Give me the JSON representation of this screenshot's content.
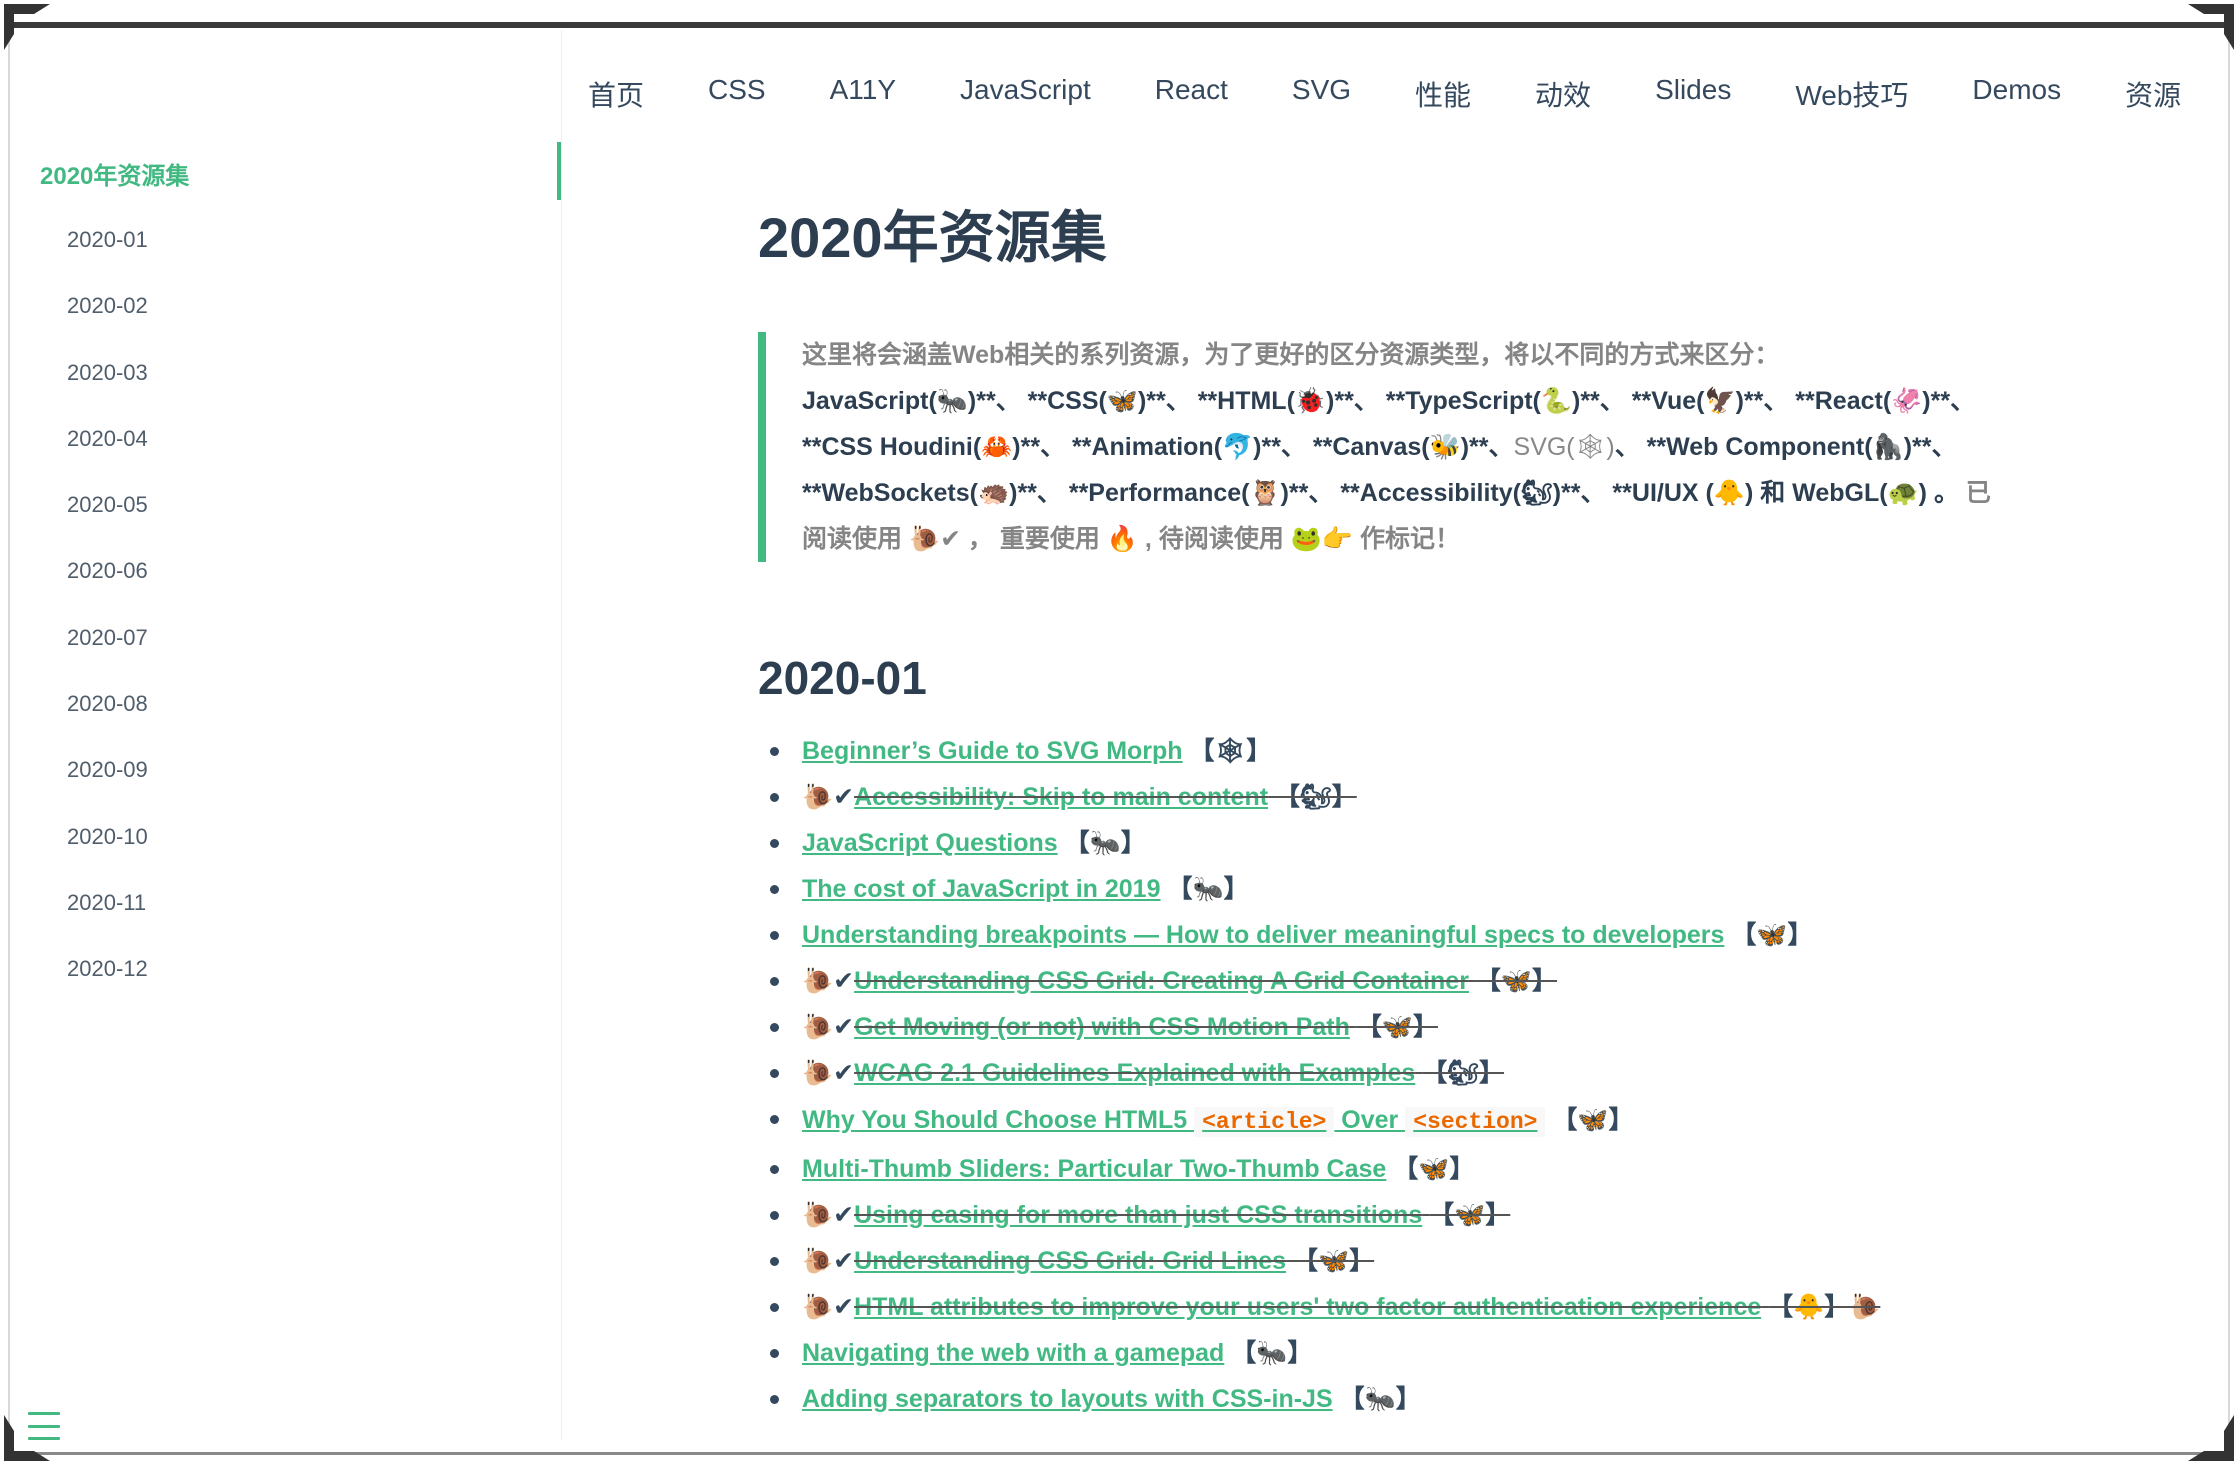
{
  "sidebar": {
    "active": "2020年资源集",
    "items": [
      "2020-01",
      "2020-02",
      "2020-03",
      "2020-04",
      "2020-05",
      "2020-06",
      "2020-07",
      "2020-08",
      "2020-09",
      "2020-10",
      "2020-11",
      "2020-12"
    ]
  },
  "nav": [
    "首页",
    "CSS",
    "A11Y",
    "JavaScript",
    "React",
    "SVG",
    "性能",
    "动效",
    "Slides",
    "Web技巧",
    "Demos",
    "资源"
  ],
  "page": {
    "title": "2020年资源集",
    "intro": {
      "line1": "这里将会涵盖Web相关的系列资源，为了更好的区分资源类型，将以不同的方式来区分：",
      "line2": "JavaScript(🐜)**、 **CSS(🦋)**、 **HTML(🐞)**、 **TypeScript(🐍)**、 **Vue(🦅)**、 **React(🦑)**、",
      "line3a": "**CSS Houdini(🦀)**、 **Animation(🐬)**、 **Canvas(🐝)**、",
      "line3svg": "SVG(🕸)",
      "line3b": "、 **Web Component(🦍)**、",
      "line4a": "**WebSockets(🦔)**、 **Performance(🦉)**、 **Accessibility(🐿)**、 **UI/UX (🐥) 和 WebGL(🐢) 。",
      "line4b": " 已",
      "line5": "阅读使用 🐌✔ ， 重要使用 🔥 , 待阅读使用 🐸👉 作标记！"
    },
    "section": "2020-01",
    "items": [
      {
        "prefix": "",
        "link": "Beginner’s Guide to SVG Morph",
        "tag": "【🕸】"
      },
      {
        "prefix": "🐌✔",
        "link": "Accessibility: Skip to main content",
        "tag": "【🐿】"
      },
      {
        "prefix": "",
        "link": "JavaScript Questions",
        "tag": "【🐜】"
      },
      {
        "prefix": "",
        "link": "The cost of JavaScript in 2019",
        "tag": "【🐜】"
      },
      {
        "prefix": "",
        "link": "Understanding breakpoints — How to deliver meaningful specs to developers",
        "tag": "【🦋】"
      },
      {
        "prefix": "🐌✔",
        "link": "Understanding CSS Grid: Creating A Grid Container",
        "tag": "【🦋】"
      },
      {
        "prefix": "🐌✔",
        "link": "Get Moving (or not) with CSS Motion Path",
        "tag": "【🦋】"
      },
      {
        "prefix": "🐌✔",
        "link": "WCAG 2.1 Guidelines Explained with Examples",
        "tag": "【🐿】"
      },
      {
        "prefix": "",
        "link": "Multi-Thumb Sliders: Particular Two-Thumb Case",
        "tag": "【🦋】"
      },
      {
        "prefix": "🐌✔",
        "link": "Using easing for more than just CSS transitions",
        "tag": "【🦋】"
      },
      {
        "prefix": "🐌✔",
        "link": "Understanding CSS Grid: Grid Lines",
        "tag": "【🦋】"
      },
      {
        "prefix": "🐌✔",
        "link": "HTML attributes to improve your users' two factor authentication experience",
        "tag": "【🐥】🐌"
      },
      {
        "prefix": "",
        "link": "Navigating the web with a gamepad",
        "tag": "【🐜】"
      },
      {
        "prefix": "",
        "link": "Adding separators to layouts with CSS-in-JS",
        "tag": "【🐜】"
      }
    ],
    "html5_item": {
      "link_a": "Why You Should Choose HTML5 ",
      "code_a": "<article>",
      "link_b": " Over ",
      "code_b": "<section>",
      "tag": "【🦋】"
    }
  }
}
